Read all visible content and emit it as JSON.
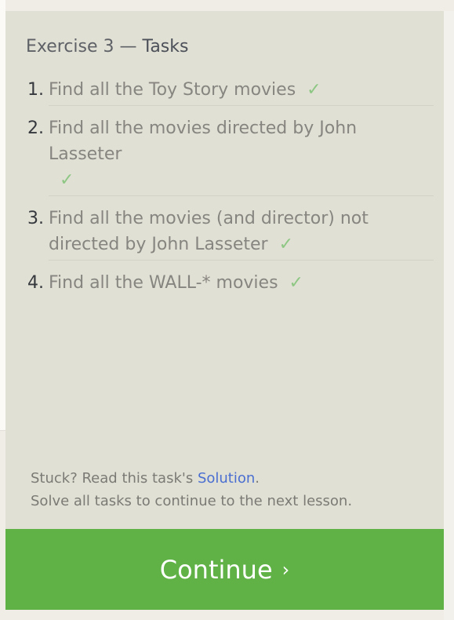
{
  "exercise": {
    "title_prefix": "Exercise 3 — ",
    "title_main": "Tasks"
  },
  "tasks": [
    {
      "number": "1.",
      "text": "Find all the Toy Story movies",
      "done_icon": "✓"
    },
    {
      "number": "2.",
      "text": "Find all the movies directed by John Lasseter",
      "done_icon": "✓"
    },
    {
      "number": "3.",
      "text": "Find all the movies (and director) not directed by John Lasseter",
      "done_icon": "✓"
    },
    {
      "number": "4.",
      "text": "Find all the WALL-* movies",
      "done_icon": "✓"
    }
  ],
  "footer": {
    "stuck_prefix": "Stuck? Read this task's ",
    "solution_link": "Solution",
    "stuck_suffix": ".",
    "instruction": "Solve all tasks to continue to the next lesson."
  },
  "continue_button": {
    "label": "Continue",
    "chevron": "›"
  },
  "colors": {
    "panel_bg": "#e1e0d5",
    "check_green": "#8ec784",
    "button_green": "#60b247",
    "link_blue": "#4a6fd0"
  }
}
